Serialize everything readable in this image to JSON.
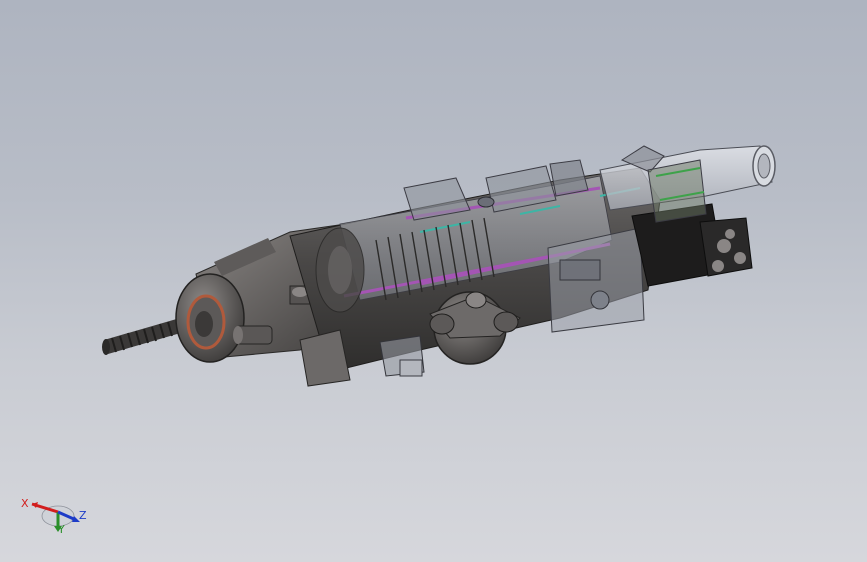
{
  "viewport": {
    "background_top": "#aeb4c0",
    "background_bottom": "#d6d7dc"
  },
  "model": {
    "description_icon": "rock-drill-assembly-icon"
  },
  "triad": {
    "x_label": "X",
    "y_label": "Y",
    "z_label": "Z",
    "x_color": "#d21e1e",
    "y_color": "#2a8f2a",
    "z_color": "#1e3cc8"
  }
}
